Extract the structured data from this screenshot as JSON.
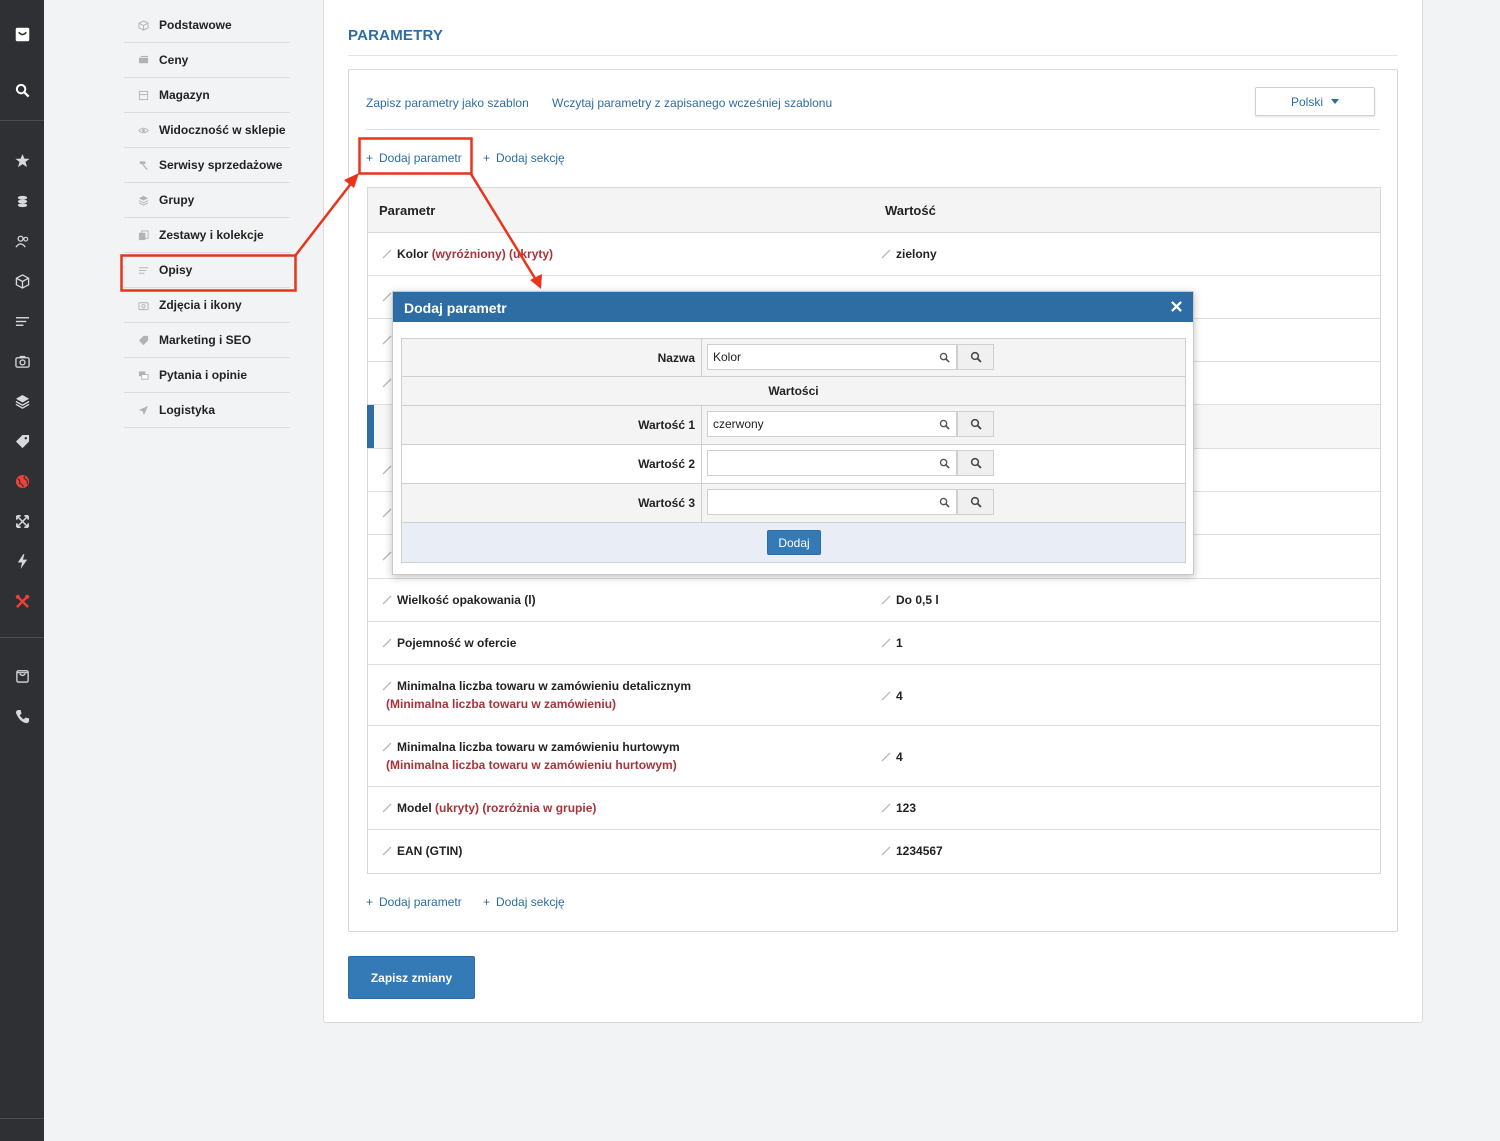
{
  "submenu": {
    "items": [
      {
        "label": "Podstawowe"
      },
      {
        "label": "Ceny"
      },
      {
        "label": "Magazyn"
      },
      {
        "label": "Widoczność w sklepie"
      },
      {
        "label": "Serwisy sprzedażowe"
      },
      {
        "label": "Grupy"
      },
      {
        "label": "Zestawy i kolekcje"
      },
      {
        "label": "Opisy"
      },
      {
        "label": "Zdjęcia i ikony"
      },
      {
        "label": "Marketing i SEO"
      },
      {
        "label": "Pytania i opinie"
      },
      {
        "label": "Logistyka"
      }
    ]
  },
  "main": {
    "title": "PARAMETRY",
    "save_template": "Zapisz parametry jako szablon",
    "load_template": "Wczytaj parametry z zapisanego wcześniej szablonu",
    "language": "Polski",
    "add_param": "Dodaj parametr",
    "add_section": "Dodaj sekcję",
    "plus": "+",
    "save_changes": "Zapisz zmiany"
  },
  "table": {
    "col_param": "Parametr",
    "col_value": "Wartość",
    "rows": [
      {
        "name": "Kolor",
        "tags": "(wyróżniony) (ukryty)",
        "value": "zielony"
      },
      {
        "name": "Wielkość opakowania (l)",
        "value": "Do 0,5 l"
      },
      {
        "name": "Pojemność w ofercie",
        "value": "1"
      },
      {
        "name": "Minimalna liczba towaru w zamówieniu detalicznym",
        "sub": "(Minimalna liczba towaru w zamówieniu)",
        "value": "4"
      },
      {
        "name": "Minimalna liczba towaru w zamówieniu hurtowym",
        "sub": "(Minimalna liczba towaru w zamówieniu hurtowym)",
        "value": "4"
      },
      {
        "name": "Model",
        "tags": "(ukryty) (rozróżnia w grupie)",
        "value": "123"
      },
      {
        "name": "EAN (GTIN)",
        "value": "1234567"
      }
    ]
  },
  "modal": {
    "title": "Dodaj parametr",
    "name_label": "Nazwa",
    "name_value": "Kolor",
    "values_header": "Wartości",
    "value_rows": [
      {
        "label": "Wartość 1",
        "value": "czerwony"
      },
      {
        "label": "Wartość 2",
        "value": ""
      },
      {
        "label": "Wartość 3",
        "value": ""
      }
    ],
    "add_button": "Dodaj"
  },
  "colors": {
    "accent": "#2e6da4",
    "tag_red": "#a8343a",
    "annotation": "#e8341c",
    "rail": "#2e3033"
  }
}
